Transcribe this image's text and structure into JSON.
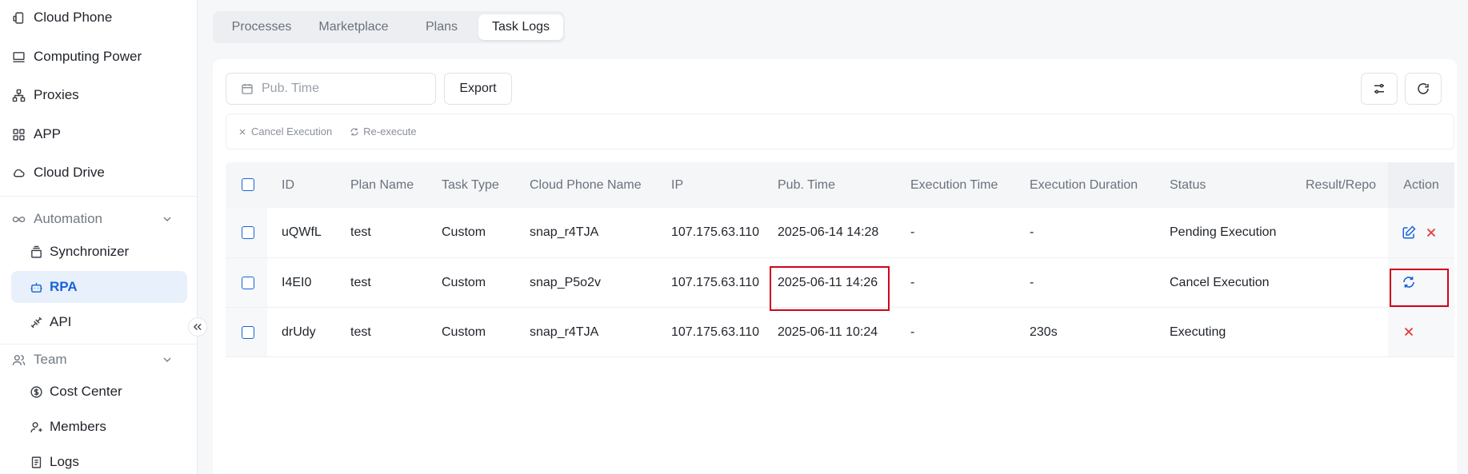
{
  "sidebar": {
    "items": [
      {
        "label": "Cloud Phone",
        "icon": "cloud-phone-icon"
      },
      {
        "label": "Computing Power",
        "icon": "monitor-icon"
      },
      {
        "label": "Proxies",
        "icon": "proxies-icon"
      },
      {
        "label": "APP",
        "icon": "apps-grid-icon"
      },
      {
        "label": "Cloud Drive",
        "icon": "cloud-icon"
      }
    ],
    "automation": {
      "label": "Automation",
      "children": [
        {
          "label": "Synchronizer",
          "icon": "synchronizer-icon"
        },
        {
          "label": "RPA",
          "icon": "robot-icon",
          "active": true
        },
        {
          "label": "API",
          "icon": "api-plug-icon"
        }
      ]
    },
    "team": {
      "label": "Team",
      "children": [
        {
          "label": "Cost Center",
          "icon": "dollar-icon"
        },
        {
          "label": "Members",
          "icon": "members-icon"
        },
        {
          "label": "Logs",
          "icon": "logs-icon"
        }
      ]
    }
  },
  "tabs": [
    {
      "label": "Processes",
      "active": false
    },
    {
      "label": "Marketplace",
      "active": false
    },
    {
      "label": "Plans",
      "active": false
    },
    {
      "label": "Task Logs",
      "active": true
    }
  ],
  "toolbar": {
    "date_placeholder": "Pub. Time",
    "export_label": "Export"
  },
  "bulk_actions": {
    "cancel_label": "Cancel Execution",
    "reexecute_label": "Re-execute"
  },
  "table": {
    "columns": [
      "ID",
      "Plan Name",
      "Task Type",
      "Cloud Phone Name",
      "IP",
      "Pub. Time",
      "Execution Time",
      "Execution Duration",
      "Status",
      "Result/Repo",
      "Action"
    ],
    "rows": [
      {
        "id": "uQWfL",
        "plan": "test",
        "type": "Custom",
        "phone": "snap_r4TJA",
        "ip": "107.175.63.110",
        "pub_time": "2025-06-14 14:28",
        "exec_time": "-",
        "duration": "-",
        "status": "Pending Execution",
        "result": "",
        "actions": [
          "edit",
          "cancel"
        ]
      },
      {
        "id": "I4EI0",
        "plan": "test",
        "type": "Custom",
        "phone": "snap_P5o2v",
        "ip": "107.175.63.110",
        "pub_time": "2025-06-11 14:26",
        "exec_time": "-",
        "duration": "-",
        "status": "Cancel Execution",
        "result": "",
        "actions": [
          "reexecute"
        ]
      },
      {
        "id": "drUdy",
        "plan": "test",
        "type": "Custom",
        "phone": "snap_r4TJA",
        "ip": "107.175.63.110",
        "pub_time": "2025-06-11 10:24",
        "exec_time": "-",
        "duration": "230s",
        "status": "Executing",
        "result": "",
        "actions": [
          "cancel"
        ]
      }
    ]
  },
  "colors": {
    "accent": "#1664d8",
    "danger": "#e53935",
    "highlight": "#d0021b"
  }
}
